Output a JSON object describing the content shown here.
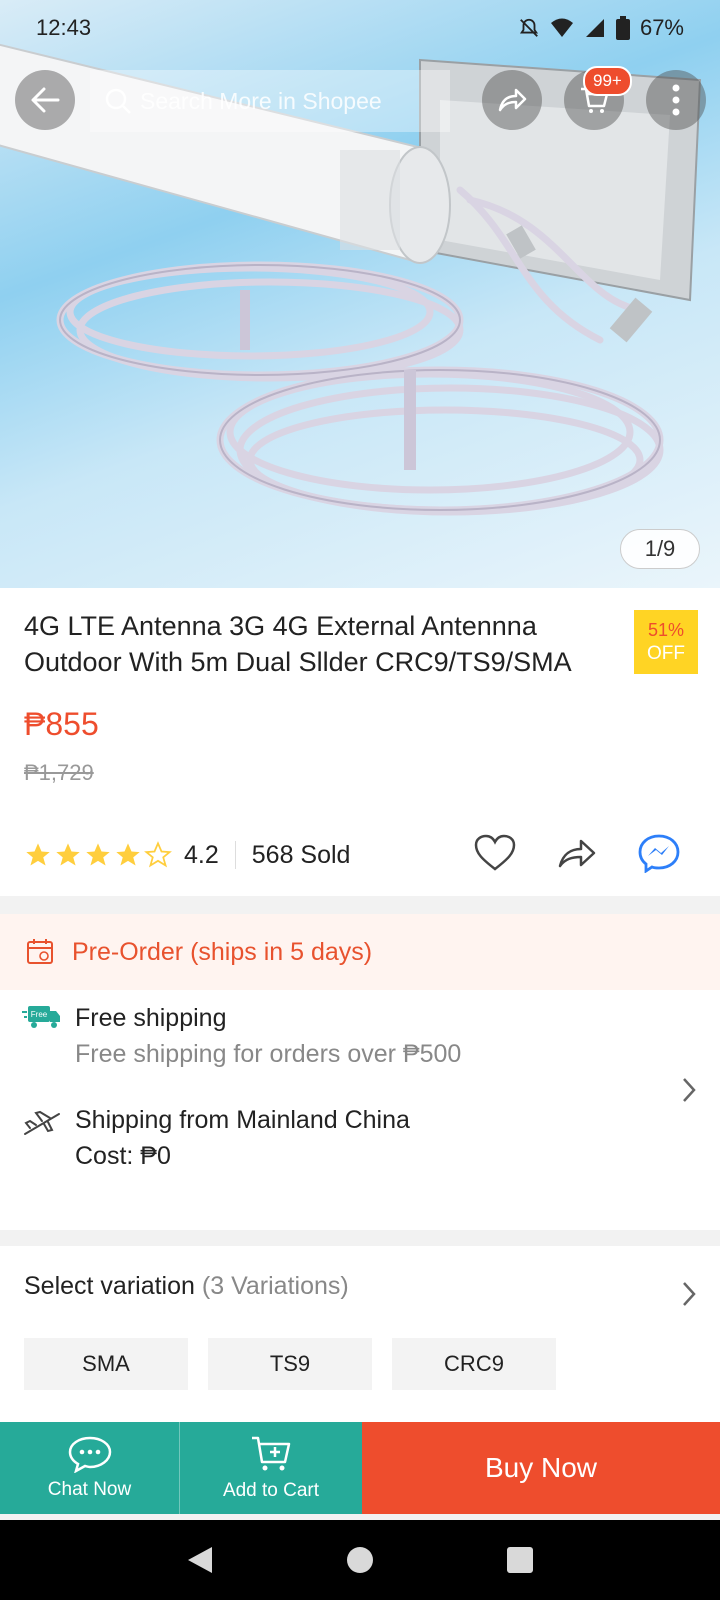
{
  "status_bar": {
    "time": "12:43",
    "battery": "67%"
  },
  "top_bar": {
    "search_placeholder": "Search More in Shopee",
    "cart_badge": "99+",
    "image_counter": "1/9"
  },
  "product": {
    "title": "4G LTE Antenna 3G 4G External Antennna Outdoor With 5m Dual Sllder CRC9/TS9/SMA",
    "discount_percent": "51%",
    "discount_label": "OFF",
    "price": "₱855",
    "original_price": "₱1,729",
    "rating": "4.2",
    "rating_stars_filled": 4,
    "sold": "568 Sold"
  },
  "preorder": {
    "text": "Pre-Order (ships in 5 days)"
  },
  "shipping": {
    "free_title": "Free shipping",
    "free_sub": "Free shipping for orders over ₱500",
    "free_badge": "Free",
    "from_title": "Shipping from Mainland China",
    "cost": "Cost: ₱0"
  },
  "variation": {
    "title": "Select variation",
    "count": "(3 Variations)",
    "options": [
      "SMA",
      "TS9",
      "CRC9"
    ]
  },
  "bottom_bar": {
    "chat_label": "Chat Now",
    "add_cart_label": "Add to Cart",
    "buy_label": "Buy Now"
  },
  "colors": {
    "brand": "#ee4d2d",
    "teal": "#26aa99",
    "discount_bg": "#ffd424",
    "star": "#ffce3d"
  }
}
